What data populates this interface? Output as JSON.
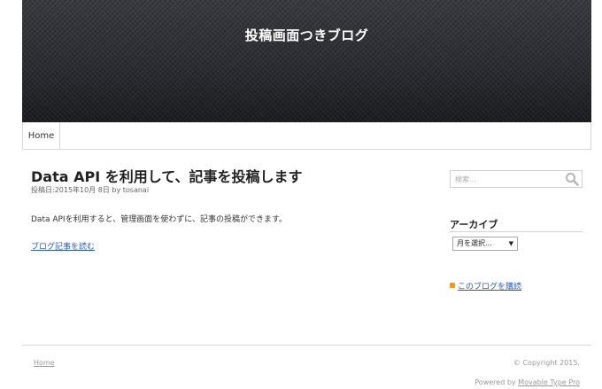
{
  "header": {
    "site_title": "投稿画面つきブログ"
  },
  "nav": {
    "items": [
      {
        "label": "Home"
      }
    ]
  },
  "post": {
    "title": "Data API を利用して、記事を投稿します",
    "meta": "投稿日:2015年10月 8日 by tosanai",
    "body": "Data APIを利用すると、管理画面を使わずに、記事の投稿ができます。",
    "read_more": "ブログ記事を読む"
  },
  "sidebar": {
    "search": {
      "placeholder": "検索...",
      "value": "",
      "icon": "search-icon"
    },
    "archive": {
      "title": "アーカイブ",
      "select_value": "月を選択..."
    },
    "feed": {
      "label": "このブログを購読",
      "icon": "feed-icon"
    }
  },
  "footer": {
    "home_link": "Home",
    "copyright": "© Copyright 2015.",
    "powered_prefix": "Powered by",
    "powered_link": "Movable Type Pro"
  },
  "colors": {
    "banner": "#2a2c31",
    "link": "#2a5db0",
    "feed_icon": "#f39a1e"
  }
}
